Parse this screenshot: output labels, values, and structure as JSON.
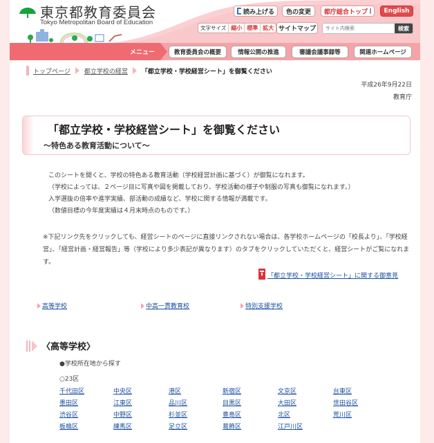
{
  "header": {
    "logo_title": "東京都教育委員会",
    "logo_subtitle": "Tokyo Metropolitan Board of Education",
    "buttons": {
      "read_aloud": "読み上げる",
      "color_change": "色の変更",
      "tokyo_top": "都庁総合トップ",
      "english": "English",
      "sitemap": "サイトマップ"
    },
    "font_size": {
      "label": "文字サイズ",
      "smaller": "縮小",
      "standard": "標準",
      "larger": "拡大"
    },
    "search": {
      "placeholder": "サイト内検索",
      "button": "検索"
    }
  },
  "nav": {
    "menu_label": "メニュー",
    "items": [
      "教育委員会の概要",
      "情報公開の推進",
      "審議会議事録等",
      "関連ホームページ"
    ]
  },
  "breadcrumb": {
    "items": [
      "トップページ",
      "都立学校の経営"
    ],
    "current": "「都立学校・学校経営シート」を御覧ください"
  },
  "meta": {
    "date": "平成26年9月22日",
    "org": "教育庁"
  },
  "title": {
    "main": "「都立学校・学校経営シート」を御覧ください",
    "sub": "～特色ある教育活動について～"
  },
  "intro": [
    "このシートを開くと、学校の特色ある教育活動（学校経営計画に基づく）が御覧になれます。",
    "（学校によっては、２ページ目に写真や図を掲載しており、学校活動の様子や制服の写真も御覧になれます。）",
    "入学選抜の倍率や進学実績、部活動の成績など、学校に関する情報が満載です。",
    "（数値目標の今年度実績は４月末時点のものです。）"
  ],
  "note": "※下記リンク先をクリックしても、経営シートのページに直接リンクされない場合は、各学校ホームページの「校長より」、「学校経営」、「経営計画・経営報告」等（学校により多少表記が異なります）のタブをクリックしていただくと、経営シートがご覧になれます。",
  "opinion_link": "「都立学校・学校経営シート」に関する御意見",
  "category_links": [
    "高等学校",
    "中高一貫教育校",
    "特別支援学校"
  ],
  "section": {
    "title": "〈高等学校〉",
    "search_by": "●学校所在地から探す",
    "area": "○23区",
    "wards": [
      [
        "千代田区",
        "中央区",
        "港区",
        "新宿区",
        "文京区",
        "台東区"
      ],
      [
        "墨田区",
        "江東区",
        "品川区",
        "目黒区",
        "大田区",
        "世田谷区"
      ],
      [
        "渋谷区",
        "中野区",
        "杉並区",
        "豊島区",
        "北区",
        "荒川区"
      ],
      [
        "板橋区",
        "練馬区",
        "足立区",
        "葛飾区",
        "江戸川区"
      ]
    ]
  },
  "colors": {
    "accent": "#f06b71",
    "nav_bg": "#f5a3a7",
    "english_btn": "#e14a4f",
    "link": "#1a4fa0",
    "page_bg": "#fdeaea"
  }
}
